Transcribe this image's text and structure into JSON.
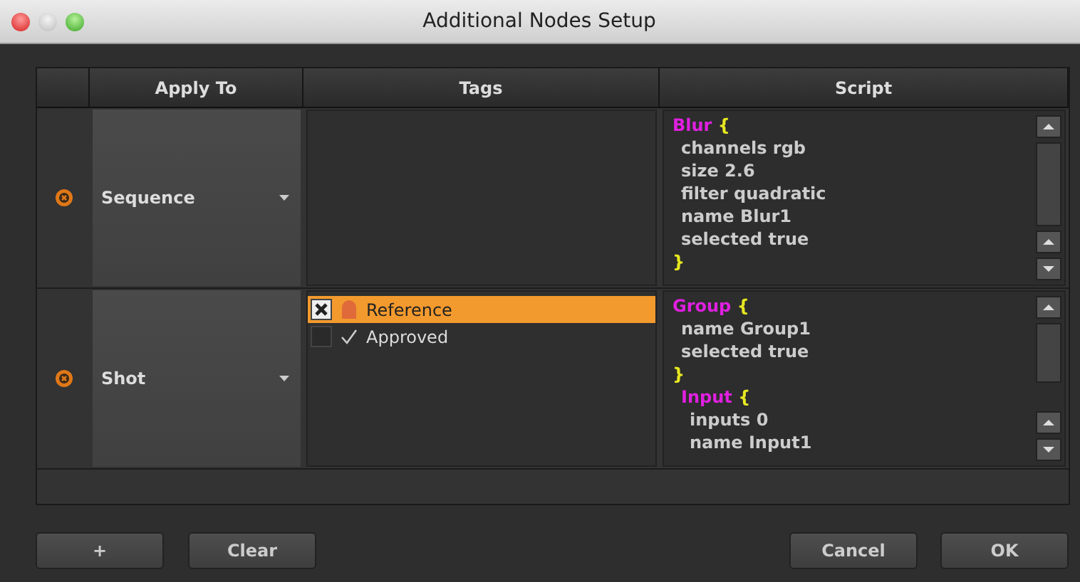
{
  "window": {
    "title": "Additional Nodes Setup"
  },
  "table": {
    "columns": [
      "Apply To",
      "Tags",
      "Script"
    ],
    "rows": [
      {
        "apply_to": "Sequence",
        "tags": [],
        "script": [
          {
            "kind": "top",
            "name": "Blur",
            "open": "{",
            "props": [
              "channels rgb",
              "size 2.6",
              "filter quadratic",
              "name Blur1",
              "selected true"
            ],
            "close": "}"
          }
        ]
      },
      {
        "apply_to": "Shot",
        "tags": [
          {
            "label": "Reference",
            "checked": true,
            "selected": true,
            "kind": "flag"
          },
          {
            "label": "Approved",
            "checked": false,
            "selected": false,
            "kind": "check"
          }
        ],
        "script": [
          {
            "kind": "top",
            "name": "Group",
            "open": "{",
            "props": [
              "name Group1",
              "selected true"
            ],
            "close": "}"
          },
          {
            "kind": "inner",
            "name": "Input",
            "open": "{",
            "props": [
              "inputs 0",
              "name Input1"
            ]
          }
        ]
      }
    ]
  },
  "buttons": {
    "left": [
      "+",
      "Clear"
    ],
    "right": [
      "Cancel",
      "OK"
    ]
  }
}
